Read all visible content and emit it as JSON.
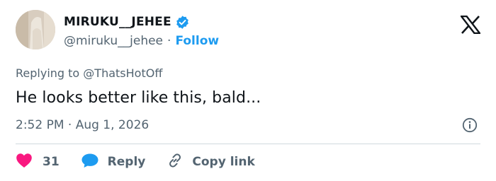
{
  "author": {
    "display_name": "MIRUKU__JEHEE",
    "handle": "@miruku__jehee",
    "separator": "·",
    "follow_label": "Follow",
    "verified": true
  },
  "reply_context": {
    "prefix": "Replying to",
    "mention": "@ThatsHotOff"
  },
  "tweet": {
    "text": "He looks better like this, bald...",
    "timestamp": "2:52 PM · Aug 1, 2026"
  },
  "actions": {
    "like_count": "31",
    "reply_label": "Reply",
    "copy_link_label": "Copy link"
  },
  "icons": {
    "verified": "verified-badge-icon",
    "logo": "x-logo-icon",
    "info": "info-icon",
    "like": "heart-icon",
    "reply": "speech-bubble-icon",
    "copy": "link-icon"
  },
  "colors": {
    "accent": "#1d9bf0",
    "like": "#f91880",
    "text": "#0f1419",
    "muted": "#536471",
    "divider": "#cfd9de"
  }
}
